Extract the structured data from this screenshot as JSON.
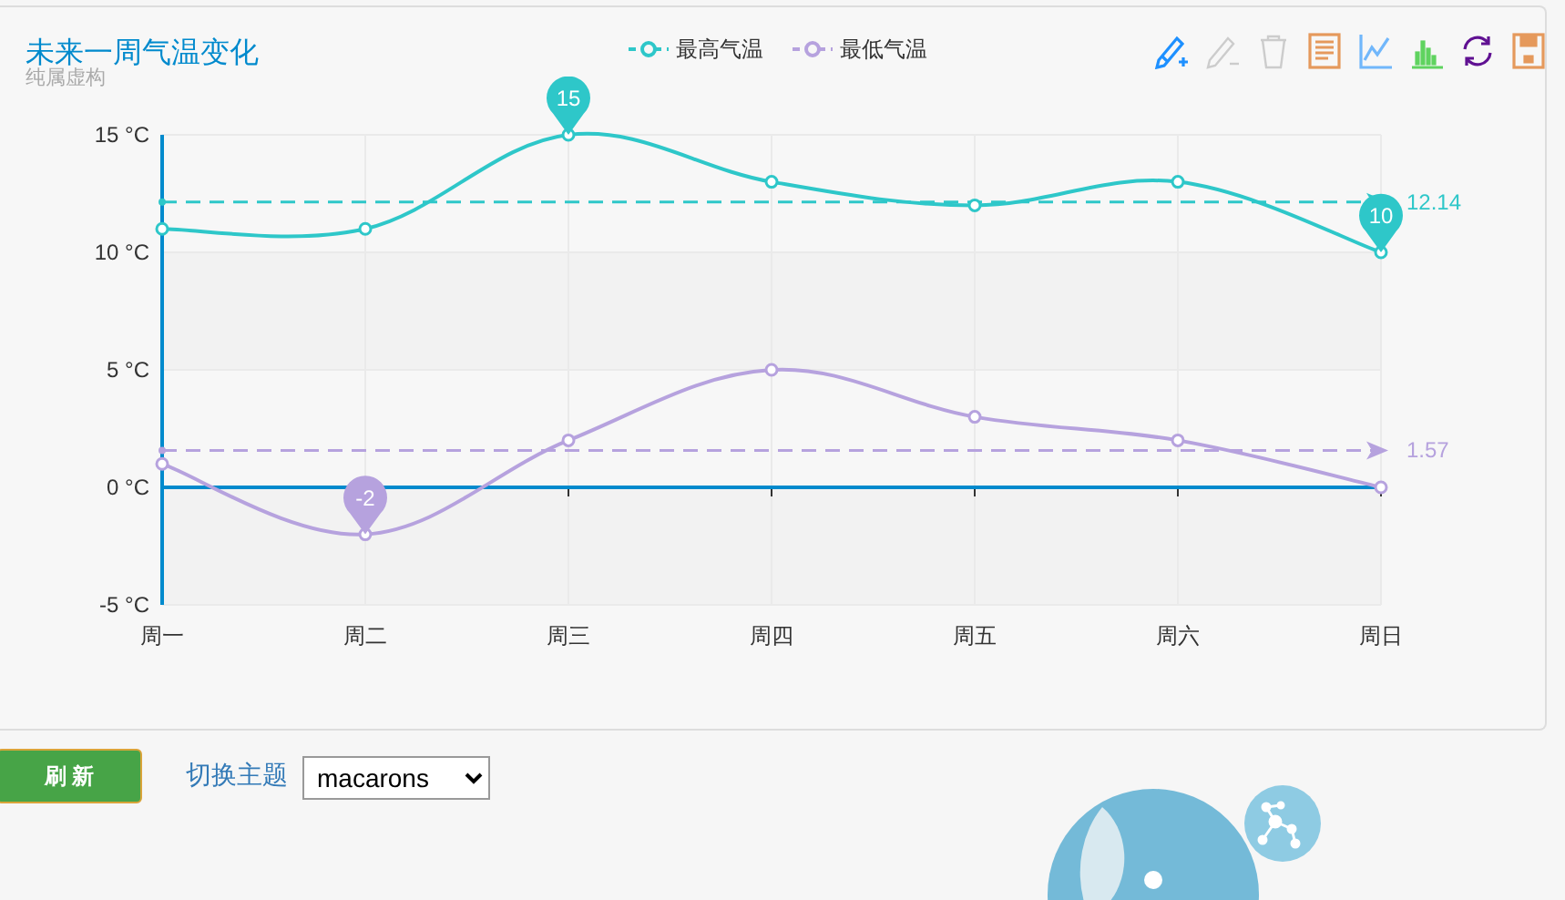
{
  "chart_panel": {
    "title": "未来一周气温变化",
    "subtitle": "纯属虚构",
    "toolbox": [
      {
        "kind": "mark",
        "color": "#1e90ff",
        "disabled": false
      },
      {
        "kind": "mark-undo",
        "color": "#cccccc",
        "disabled": true
      },
      {
        "kind": "mark-clear",
        "color": "#cccccc",
        "disabled": true
      },
      {
        "kind": "data-view",
        "color": "#e5995c",
        "disabled": false
      },
      {
        "kind": "line",
        "color": "#71b7fb",
        "disabled": false
      },
      {
        "kind": "bar",
        "color": "#5fd35f",
        "disabled": false
      },
      {
        "kind": "restore",
        "color": "#601192",
        "disabled": false
      },
      {
        "kind": "save",
        "color": "#e5995c",
        "disabled": false
      }
    ],
    "chart_data": {
      "type": "line",
      "grid": true,
      "categories": [
        "周一",
        "周二",
        "周三",
        "周四",
        "周五",
        "周六",
        "周日"
      ],
      "ylim": [
        -5,
        15
      ],
      "yticks": [
        {
          "value": -5,
          "label": "-5 °C"
        },
        {
          "value": 0,
          "label": "0 °C"
        },
        {
          "value": 5,
          "label": "5 °C"
        },
        {
          "value": 10,
          "label": "10 °C"
        },
        {
          "value": 15,
          "label": "15 °C"
        }
      ],
      "series": [
        {
          "name": "最高气温",
          "color": "#2ec7c9",
          "marker": "circle",
          "values": [
            11,
            11,
            15,
            13,
            12,
            13,
            10
          ]
        },
        {
          "name": "最低气温",
          "color": "#b6a2de",
          "marker": "circle",
          "values": [
            1,
            -2,
            2,
            5,
            3,
            2,
            0
          ]
        }
      ],
      "ref_lines": [
        {
          "axis": "y",
          "value": 12.14,
          "label": "12.14",
          "color": "#2ec7c9"
        },
        {
          "axis": "y",
          "value": 1.57,
          "label": "1.57",
          "color": "#b6a2de"
        },
        {
          "axis": "y",
          "value": 0,
          "color": "#008acd"
        }
      ],
      "annotations": [
        {
          "x": "周三",
          "y": 15,
          "text": "15"
        },
        {
          "x": "周日",
          "y": 10,
          "text": "10"
        },
        {
          "x": "周二",
          "y": -2,
          "text": "-2"
        }
      ]
    }
  },
  "controls": {
    "refresh_button": "刷 新",
    "theme_label": "切换主题",
    "theme_select": {
      "value": "macarons"
    }
  }
}
